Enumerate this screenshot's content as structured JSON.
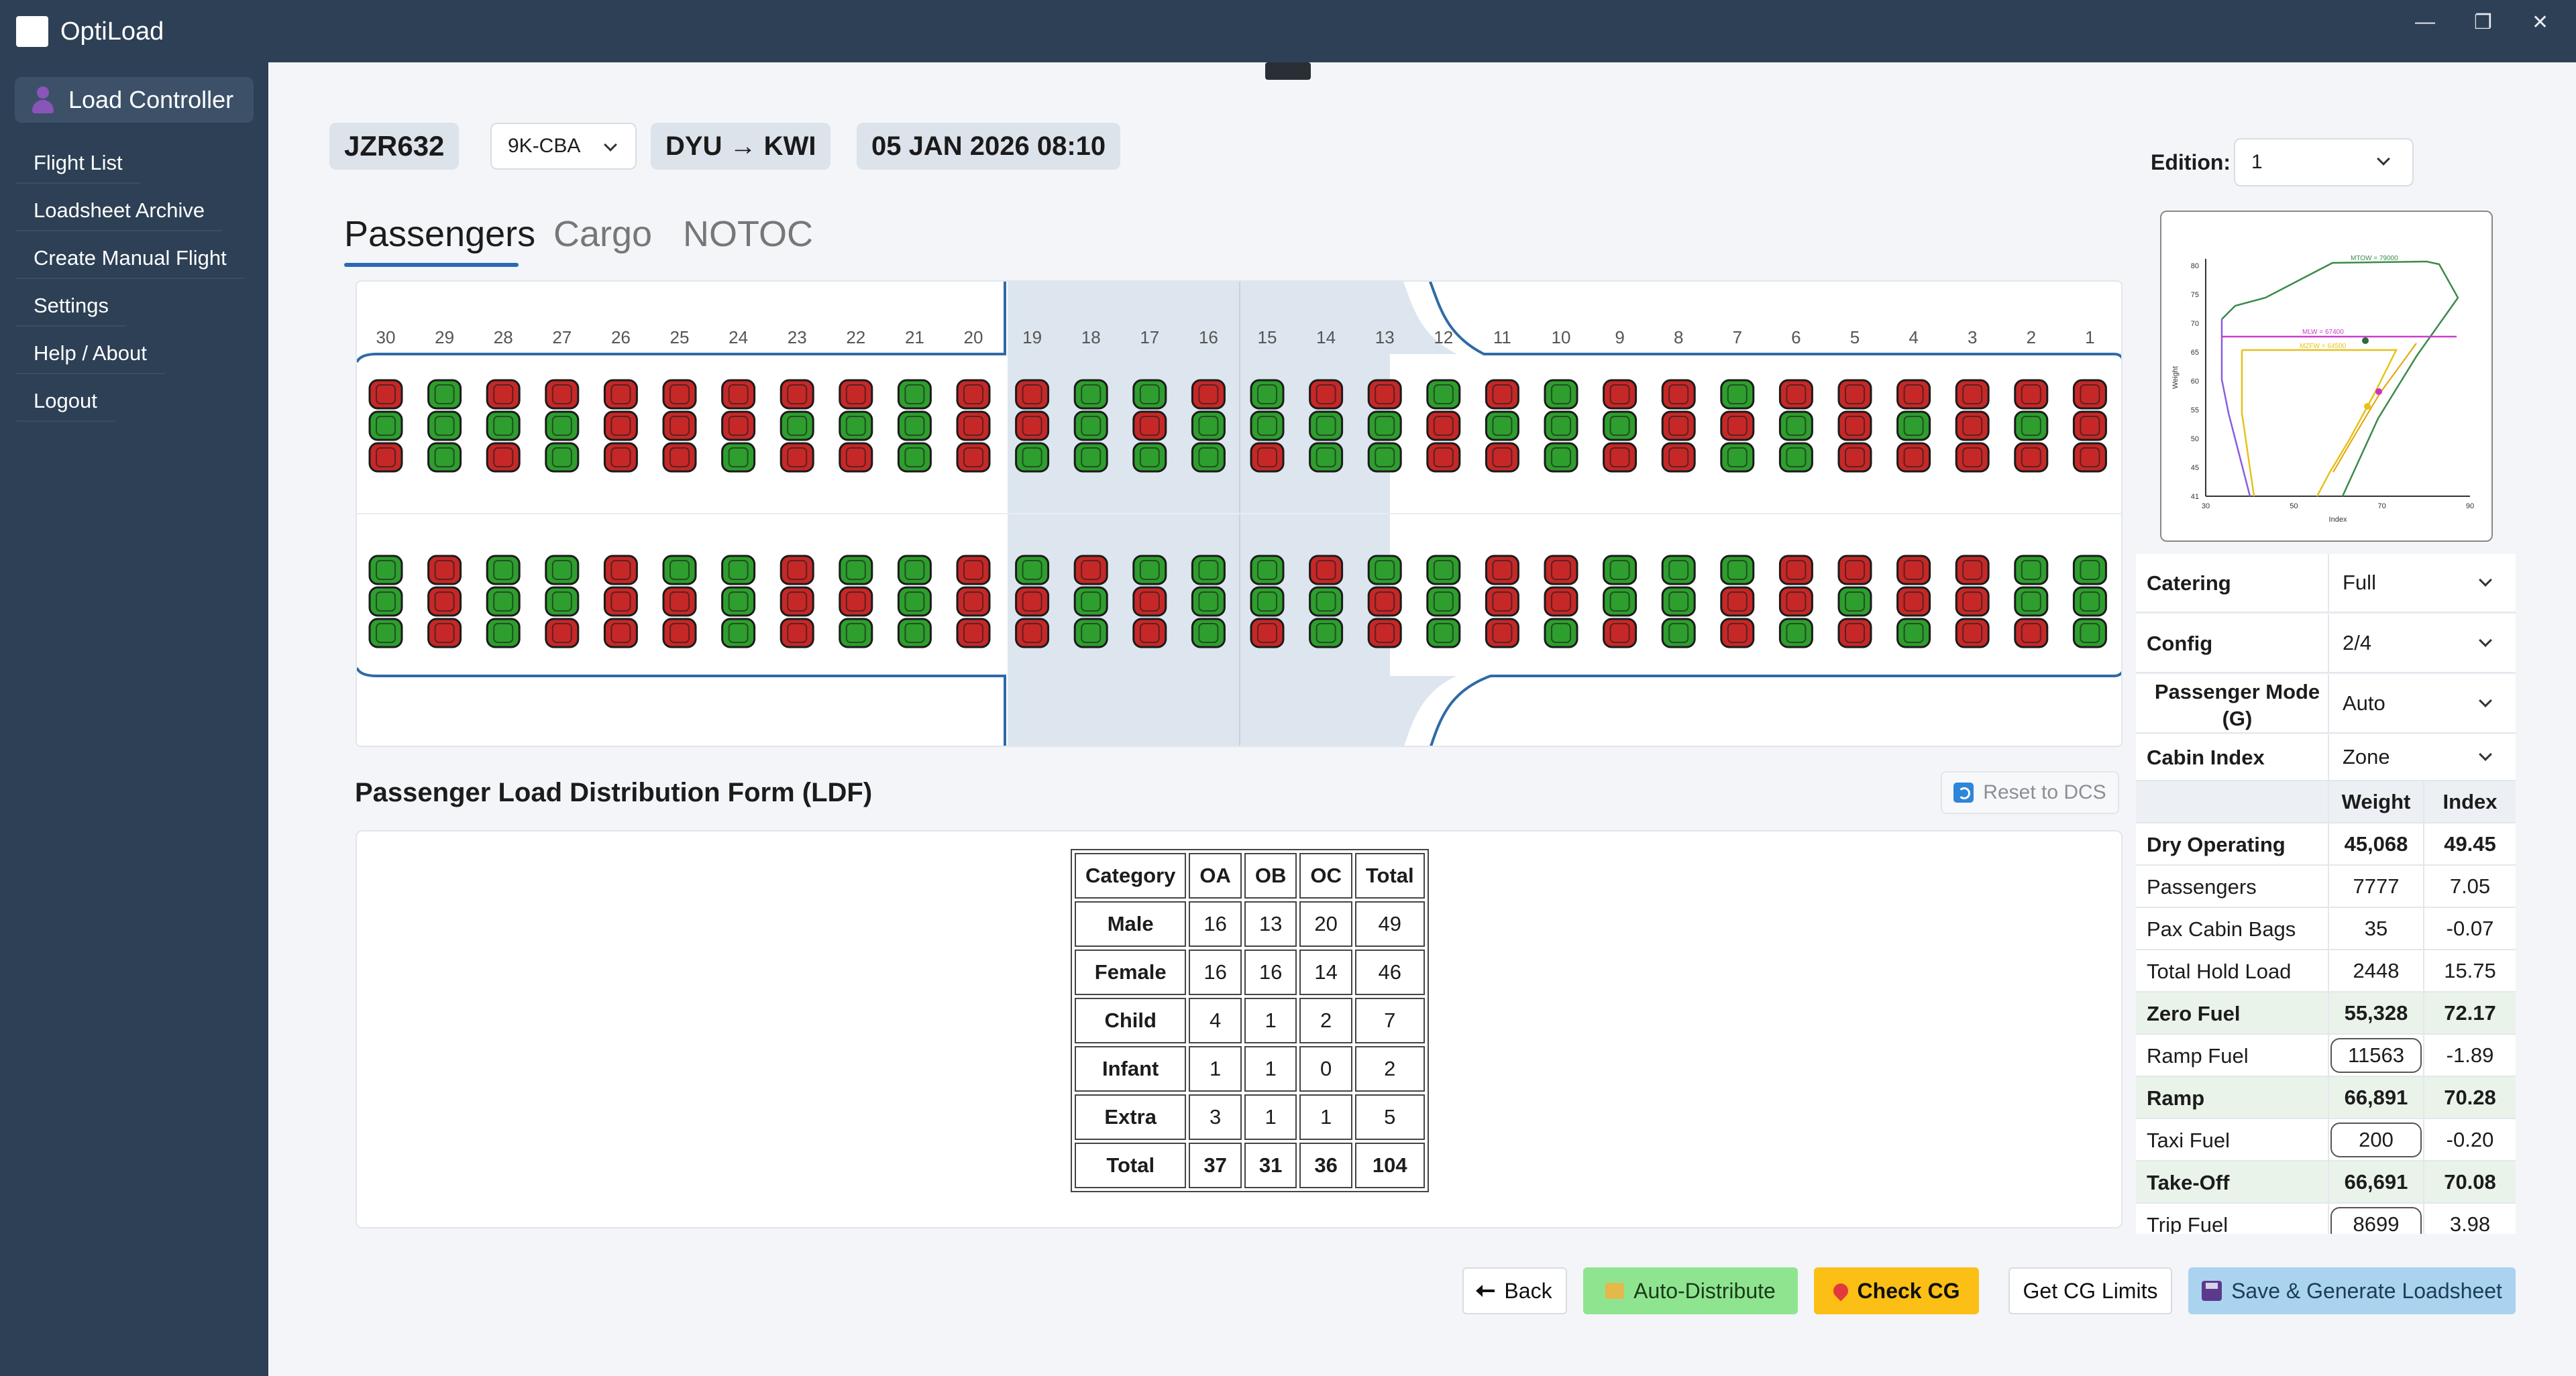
{
  "app": {
    "title": "OptiLoad"
  },
  "sidebar": {
    "controller_label": "Load Controller",
    "items": [
      {
        "label": "Flight List"
      },
      {
        "label": "Loadsheet Archive"
      },
      {
        "label": "Create Manual Flight"
      },
      {
        "label": "Settings"
      },
      {
        "label": "Help / About"
      },
      {
        "label": "Logout"
      }
    ]
  },
  "flight": {
    "number": "JZR632",
    "registration": "9K-CBA",
    "route": "DYU → KWI",
    "datetime": "05 JAN 2026 08:10"
  },
  "edition": {
    "label": "Edition:",
    "value": "1"
  },
  "tabs": [
    {
      "label": "Passengers"
    },
    {
      "label": "Cargo"
    },
    {
      "label": "NOTOC"
    }
  ],
  "seat_map": {
    "rows": [
      30,
      29,
      28,
      27,
      26,
      25,
      24,
      23,
      22,
      21,
      20,
      19,
      18,
      17,
      16,
      15,
      14,
      13,
      12,
      11,
      10,
      9,
      8,
      7,
      6,
      5,
      4,
      3,
      2,
      1
    ],
    "colors": {
      "occupied": "#c62828",
      "vacant": "#2e9e2e"
    },
    "upper_block": [
      [
        "r",
        "g",
        "r",
        "r",
        "r",
        "r",
        "r",
        "r",
        "r",
        "g",
        "r",
        "r",
        "g",
        "g",
        "r",
        "g",
        "r",
        "r",
        "g",
        "r",
        "g",
        "r",
        "r",
        "g",
        "r",
        "r",
        "r",
        "r",
        "r",
        "r"
      ],
      [
        "g",
        "g",
        "g",
        "g",
        "r",
        "r",
        "r",
        "g",
        "g",
        "g",
        "r",
        "r",
        "g",
        "r",
        "g",
        "g",
        "g",
        "g",
        "r",
        "g",
        "g",
        "g",
        "r",
        "r",
        "g",
        "r",
        "g",
        "r",
        "g",
        "r"
      ],
      [
        "r",
        "g",
        "r",
        "g",
        "r",
        "r",
        "g",
        "r",
        "r",
        "g",
        "r",
        "g",
        "g",
        "g",
        "g",
        "r",
        "g",
        "g",
        "r",
        "r",
        "g",
        "r",
        "r",
        "g",
        "g",
        "r",
        "r",
        "r",
        "r",
        "r"
      ]
    ],
    "lower_block": [
      [
        "g",
        "r",
        "g",
        "g",
        "r",
        "g",
        "g",
        "r",
        "g",
        "g",
        "r",
        "g",
        "r",
        "g",
        "g",
        "g",
        "r",
        "g",
        "g",
        "r",
        "r",
        "g",
        "g",
        "g",
        "r",
        "r",
        "r",
        "r",
        "g",
        "g"
      ],
      [
        "g",
        "r",
        "g",
        "g",
        "r",
        "r",
        "g",
        "r",
        "r",
        "g",
        "r",
        "r",
        "g",
        "r",
        "g",
        "g",
        "g",
        "r",
        "g",
        "r",
        "r",
        "g",
        "g",
        "r",
        "r",
        "g",
        "r",
        "r",
        "g",
        "g"
      ],
      [
        "g",
        "r",
        "g",
        "r",
        "r",
        "r",
        "g",
        "r",
        "g",
        "g",
        "r",
        "r",
        "g",
        "r",
        "g",
        "r",
        "g",
        "r",
        "g",
        "r",
        "g",
        "r",
        "g",
        "r",
        "g",
        "r",
        "g",
        "r",
        "r",
        "g"
      ]
    ]
  },
  "ldf": {
    "title": "Passenger Load Distribution Form (LDF)",
    "reset_label": "Reset to DCS",
    "headers": [
      "Category",
      "OA",
      "OB",
      "OC",
      "Total"
    ],
    "rows": [
      {
        "category": "Male",
        "oa": "16",
        "ob": "13",
        "oc": "20",
        "total": "49"
      },
      {
        "category": "Female",
        "oa": "16",
        "ob": "16",
        "oc": "14",
        "total": "46"
      },
      {
        "category": "Child",
        "oa": "4",
        "ob": "1",
        "oc": "2",
        "total": "7"
      },
      {
        "category": "Infant",
        "oa": "1",
        "ob": "1",
        "oc": "0",
        "total": "2"
      },
      {
        "category": "Extra",
        "oa": "3",
        "ob": "1",
        "oc": "1",
        "total": "5"
      },
      {
        "category": "Total",
        "oa": "37",
        "ob": "31",
        "oc": "36",
        "total": "104"
      }
    ]
  },
  "cg_chart": {
    "xlabel": "Index",
    "ylabel": "Weight",
    "x_ticks": [
      "30",
      "50",
      "70",
      "90"
    ],
    "y_ticks": [
      "80",
      "75",
      "70",
      "65",
      "60",
      "55",
      "50",
      "45",
      "41"
    ],
    "limits": [
      "MTOW = 79000",
      "MLW = 67400",
      "MZFW = 64500"
    ],
    "colors": {
      "envelope": "#3b8a4a",
      "mlw": "#c93fc9",
      "mzfw": "#e6c21a",
      "aft": "#e0a400",
      "fwd": "#8a5ce0"
    }
  },
  "settings": [
    {
      "label": "Catering",
      "value": "Full"
    },
    {
      "label": "Config",
      "value": "2/4"
    },
    {
      "label": "Passenger Mode (G)",
      "value": "Auto"
    },
    {
      "label": "Cabin Index",
      "value": "Zone"
    }
  ],
  "weights": {
    "headers": {
      "weight": "Weight",
      "index": "Index"
    },
    "rows": [
      {
        "name": "Dry Operating",
        "weight": "45,068",
        "index": "49.45"
      },
      {
        "name": "Passengers",
        "weight": "7777",
        "index": "7.05"
      },
      {
        "name": "Pax Cabin Bags",
        "weight": "35",
        "index": "-0.07"
      },
      {
        "name": "Total Hold Load",
        "weight": "2448",
        "index": "15.75"
      },
      {
        "name": "Zero Fuel",
        "weight": "55,328",
        "index": "72.17"
      },
      {
        "name": "Ramp Fuel",
        "weight": "11563",
        "index": "-1.89"
      },
      {
        "name": "Ramp",
        "weight": "66,891",
        "index": "70.28"
      },
      {
        "name": "Taxi Fuel",
        "weight": "200",
        "index": "-0.20"
      },
      {
        "name": "Take-Off",
        "weight": "66,691",
        "index": "70.08"
      },
      {
        "name": "Trip Fuel",
        "weight": "8699",
        "index": "3.98"
      }
    ]
  },
  "actions": {
    "back": "Back",
    "auto_distribute": "Auto-Distribute",
    "check_cg": "Check CG",
    "get_limits": "Get CG Limits",
    "save": "Save & Generate Loadsheet"
  }
}
